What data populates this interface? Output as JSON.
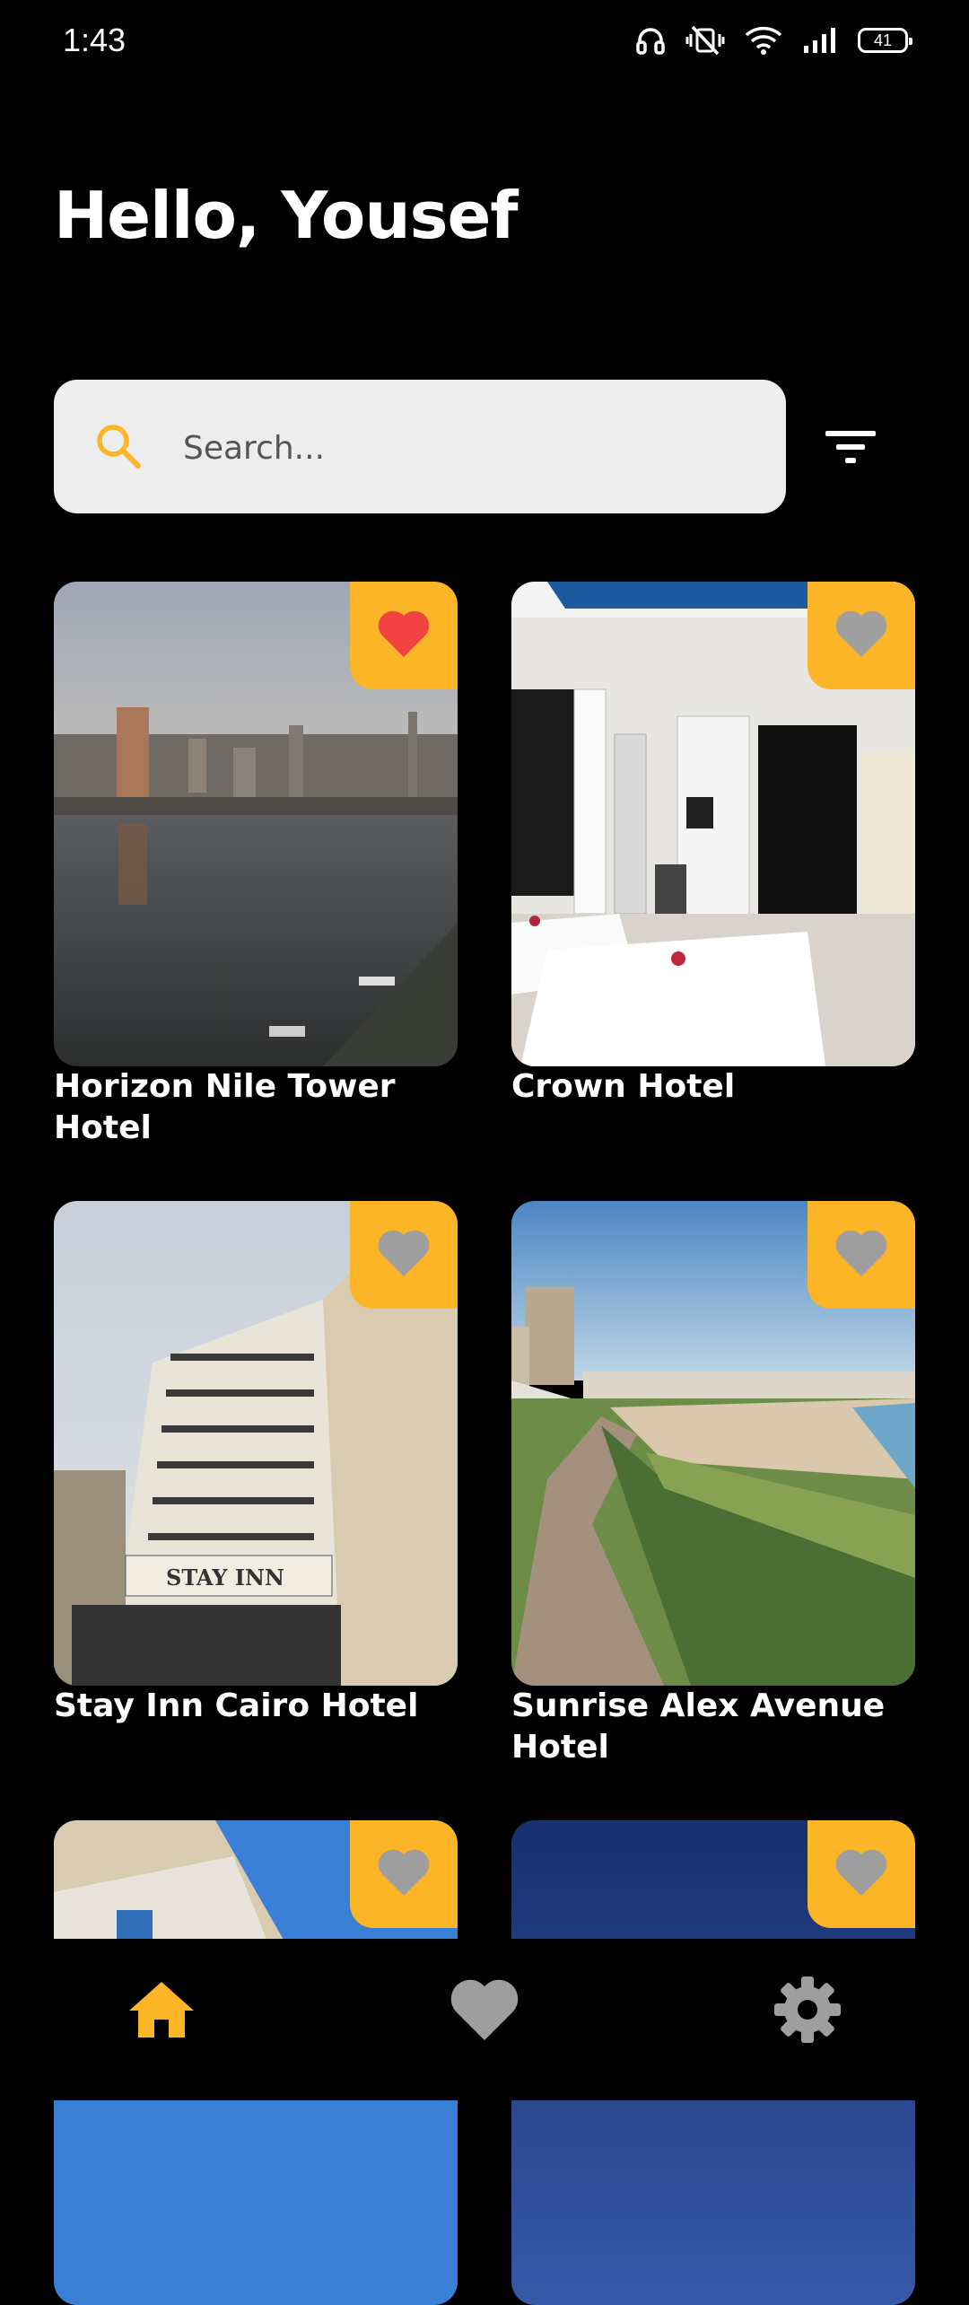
{
  "status_bar": {
    "time": "1:43",
    "battery": "41",
    "icons": [
      "headphones-icon",
      "vibrate-off-icon",
      "wifi-icon",
      "signal-icon",
      "battery-icon"
    ]
  },
  "greeting": "Hello, Yousef",
  "search": {
    "placeholder": "Search...",
    "value": ""
  },
  "colors": {
    "accent": "#fbb526",
    "favorite_active": "#f24343",
    "favorite_inactive": "#9e9e9e",
    "background": "#000000",
    "search_bg": "#ededed"
  },
  "hotels": [
    {
      "name": "Horizon Nile Tower Hotel",
      "favorite": true
    },
    {
      "name": "Crown Hotel",
      "favorite": false
    },
    {
      "name": "Stay Inn Cairo Hotel",
      "favorite": false
    },
    {
      "name": "Sunrise Alex Avenue Hotel",
      "favorite": false
    },
    {
      "name": "",
      "favorite": false
    },
    {
      "name": "",
      "favorite": false
    }
  ],
  "bottom_nav": {
    "items": [
      {
        "icon": "home-icon",
        "active": true
      },
      {
        "icon": "heart-icon",
        "active": false
      },
      {
        "icon": "gear-icon",
        "active": false
      }
    ]
  }
}
